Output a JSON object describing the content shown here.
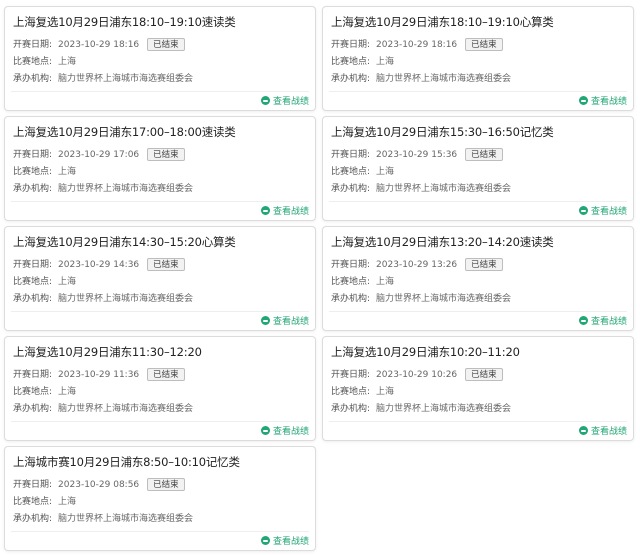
{
  "labels": {
    "date": "开赛日期:",
    "place": "比赛地点:",
    "organizer": "承办机构:",
    "status_badge": "已结束",
    "view_link": "查看战绩"
  },
  "accent_color": "#21a675",
  "cards": [
    {
      "title": "上海复选10月29日浦东18:10–19:10速读类",
      "date": "2023-10-29 18:16",
      "place": "上海",
      "organizer": "脑力世界杯上海城市海选赛组委会"
    },
    {
      "title": "上海复选10月29日浦东18:10–19:10心算类",
      "date": "2023-10-29 18:16",
      "place": "上海",
      "organizer": "脑力世界杯上海城市海选赛组委会"
    },
    {
      "title": "上海复选10月29日浦东17:00–18:00速读类",
      "date": "2023-10-29 17:06",
      "place": "上海",
      "organizer": "脑力世界杯上海城市海选赛组委会"
    },
    {
      "title": "上海复选10月29日浦东15:30–16:50记忆类",
      "date": "2023-10-29 15:36",
      "place": "上海",
      "organizer": "脑力世界杯上海城市海选赛组委会"
    },
    {
      "title": "上海复选10月29日浦东14:30–15:20心算类",
      "date": "2023-10-29 14:36",
      "place": "上海",
      "organizer": "脑力世界杯上海城市海选赛组委会"
    },
    {
      "title": "上海复选10月29日浦东13:20–14:20速读类",
      "date": "2023-10-29 13:26",
      "place": "上海",
      "organizer": "脑力世界杯上海城市海选赛组委会"
    },
    {
      "title": "上海复选10月29日浦东11:30–12:20",
      "date": "2023-10-29 11:36",
      "place": "上海",
      "organizer": "脑力世界杯上海城市海选赛组委会"
    },
    {
      "title": "上海复选10月29日浦东10:20–11:20",
      "date": "2023-10-29 10:26",
      "place": "上海",
      "organizer": "脑力世界杯上海城市海选赛组委会"
    },
    {
      "title": "上海城市赛10月29日浦东8:50–10:10记忆类",
      "date": "2023-10-29 08:56",
      "place": "上海",
      "organizer": "脑力世界杯上海城市海选赛组委会"
    }
  ]
}
